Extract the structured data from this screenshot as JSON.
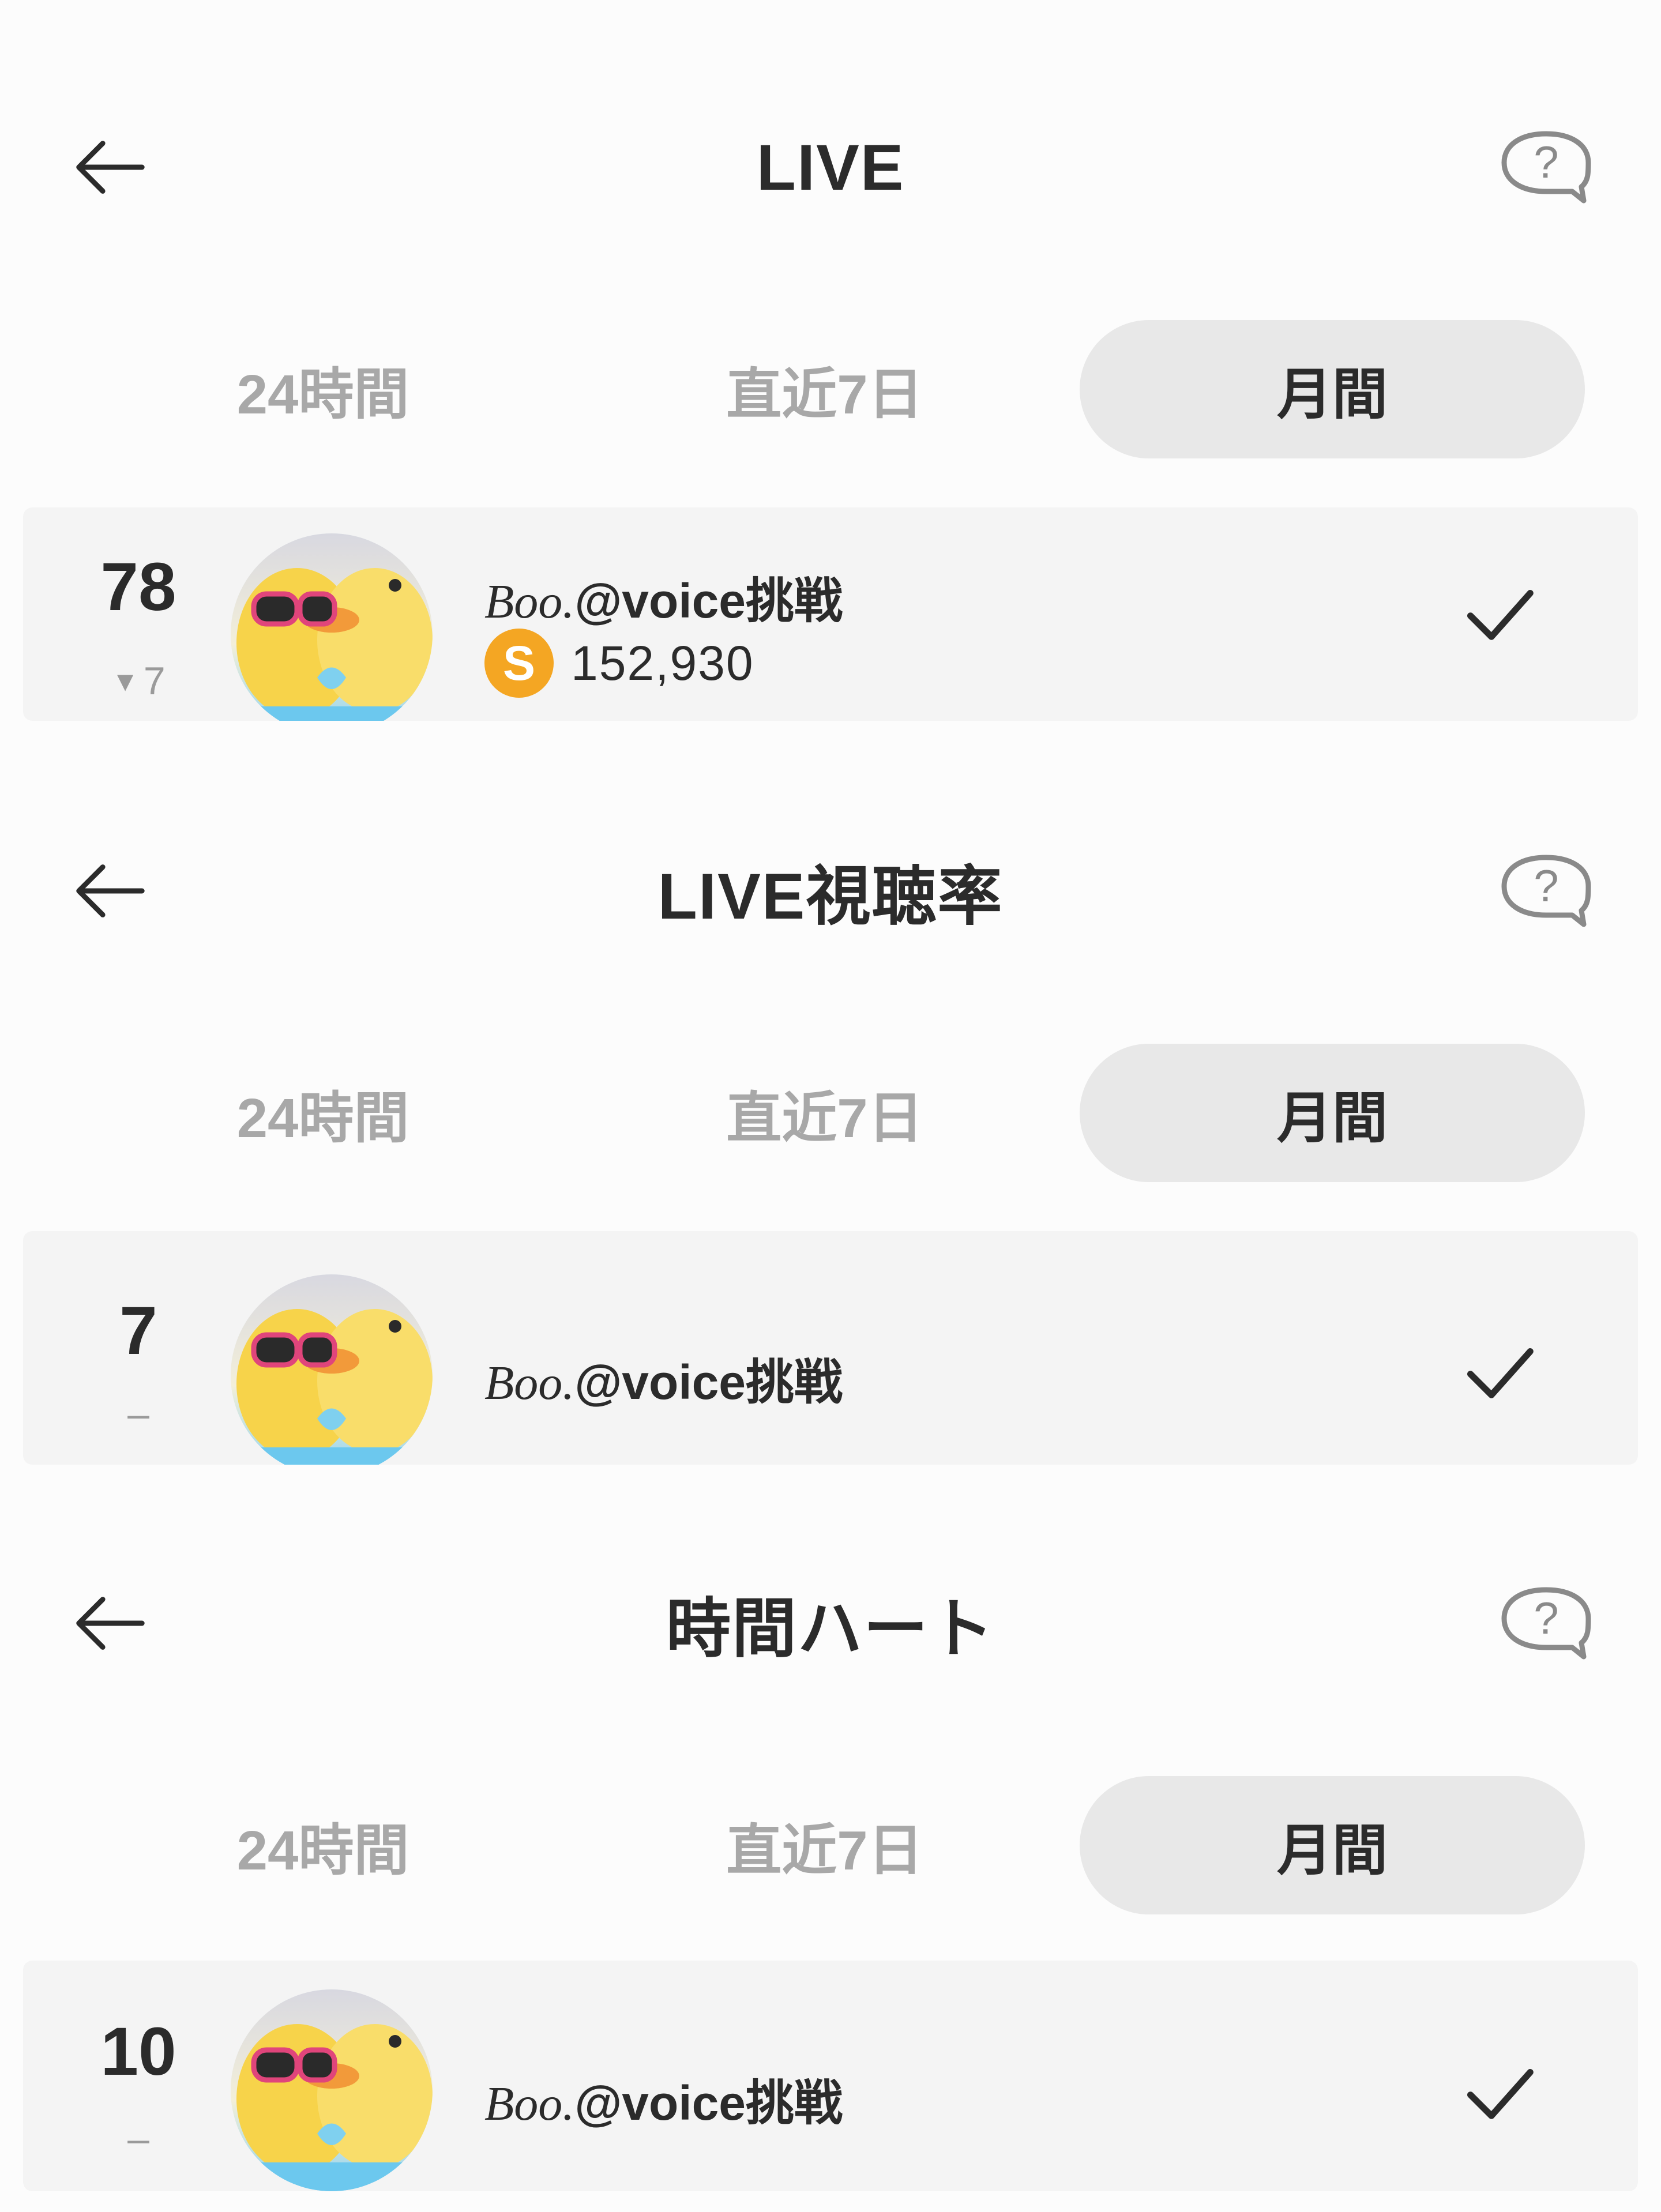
{
  "sections": [
    {
      "title": "LIVE",
      "tabs": [
        "24時間",
        "直近7日",
        "月間"
      ],
      "active_tab": "月間",
      "entry": {
        "rank": "78",
        "rank_change": "7",
        "rank_change_icon": "down-triangle-icon",
        "username_prefix": "Boo.",
        "username_suffix": "@voice挑戦",
        "score_icon_letter": "S",
        "score": "152,930"
      }
    },
    {
      "title": "LIVE視聴率",
      "tabs": [
        "24時間",
        "直近7日",
        "月間"
      ],
      "active_tab": "月間",
      "entry": {
        "rank": "7",
        "rank_change": "–",
        "username_prefix": "Boo.",
        "username_suffix": "@voice挑戦"
      }
    },
    {
      "title": "時間ハート",
      "tabs": [
        "24時間",
        "直近7日",
        "月間"
      ],
      "active_tab": "月間",
      "entry": {
        "rank": "10",
        "rank_change": "–",
        "username_prefix": "Boo.",
        "username_suffix": "@voice挑戦"
      }
    }
  ],
  "colors": {
    "background": "#fcfcfc",
    "row_background": "#f4f4f4",
    "active_tab_background": "#e8e8e8",
    "inactive_tab_text": "#a8a8a8",
    "text": "#2b2b2b",
    "coin": "#f4a623"
  },
  "icons": {
    "back": "arrow-left-icon",
    "help": "question-bubble-icon",
    "selected": "checkmark-icon",
    "avatar": "duck-avatar-image"
  }
}
